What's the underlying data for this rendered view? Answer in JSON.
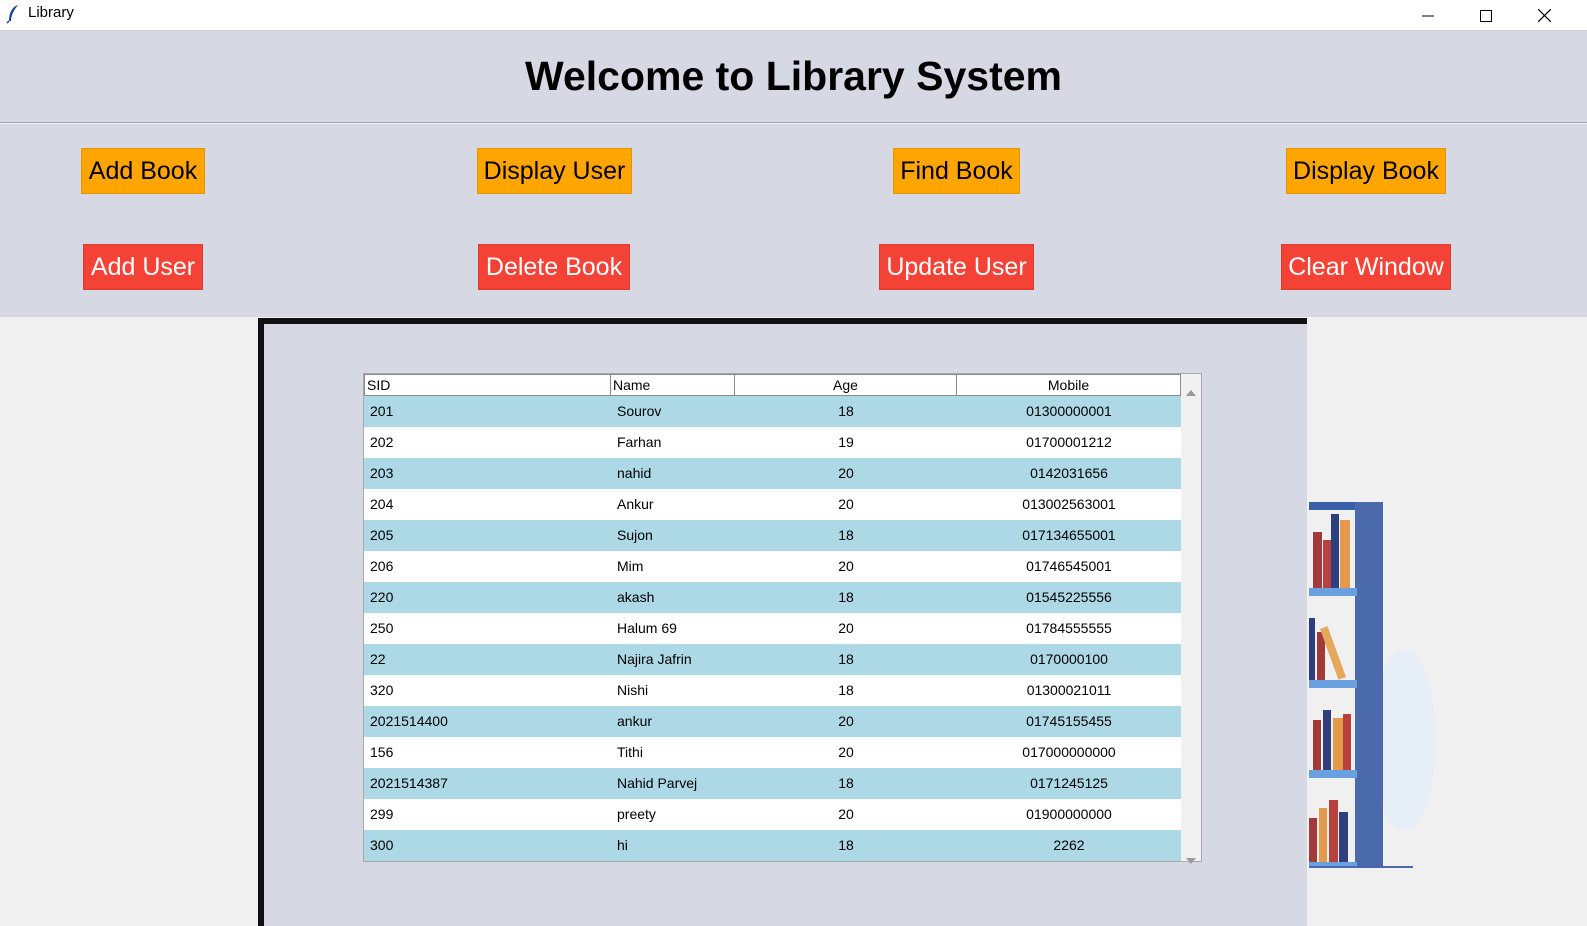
{
  "window": {
    "title": "Library",
    "icon": "feather-icon",
    "controls": [
      "minimize-icon",
      "maximize-icon",
      "close-icon"
    ]
  },
  "header": {
    "title": "Welcome to Library System"
  },
  "buttons": {
    "add_book": "Add Book",
    "display_user": "Display User",
    "find_book": "Find Book",
    "display_book": "Display Book",
    "add_user": "Add User",
    "delete_book": "Delete Book",
    "update_user": "Update User",
    "clear_window": "Clear Window"
  },
  "colors": {
    "orange_button": "#ffa500",
    "red_button": "#f44336",
    "row_highlight": "#add8e6",
    "panel_bg": "#d6d9e3"
  },
  "table": {
    "columns": [
      "SID",
      "Name",
      "Age",
      "Mobile"
    ],
    "rows": [
      [
        "201",
        "Sourov",
        "18",
        "01300000001"
      ],
      [
        "202",
        "Farhan",
        "19",
        "01700001212"
      ],
      [
        "203",
        "nahid",
        "20",
        "0142031656"
      ],
      [
        "204",
        "Ankur",
        "20",
        "013002563001"
      ],
      [
        "205",
        "Sujon",
        "18",
        "017134655001"
      ],
      [
        "206",
        "Mim",
        "20",
        "01746545001"
      ],
      [
        "220",
        "akash",
        "18",
        "01545225556"
      ],
      [
        "250",
        "Halum 69",
        "20",
        "01784555555"
      ],
      [
        "22",
        "Najira Jafrin",
        "18",
        "0170000100"
      ],
      [
        "320",
        "Nishi",
        "18",
        "01300021011"
      ],
      [
        "2021514400",
        "ankur",
        "20",
        "01745155455"
      ],
      [
        "156",
        "Tithi",
        "20",
        "017000000000"
      ],
      [
        "2021514387",
        "Nahid Parvej",
        "18",
        "0171245125"
      ],
      [
        "299",
        "preety",
        "20",
        "01900000000"
      ],
      [
        "300",
        "hi",
        "18",
        "2262"
      ]
    ]
  }
}
